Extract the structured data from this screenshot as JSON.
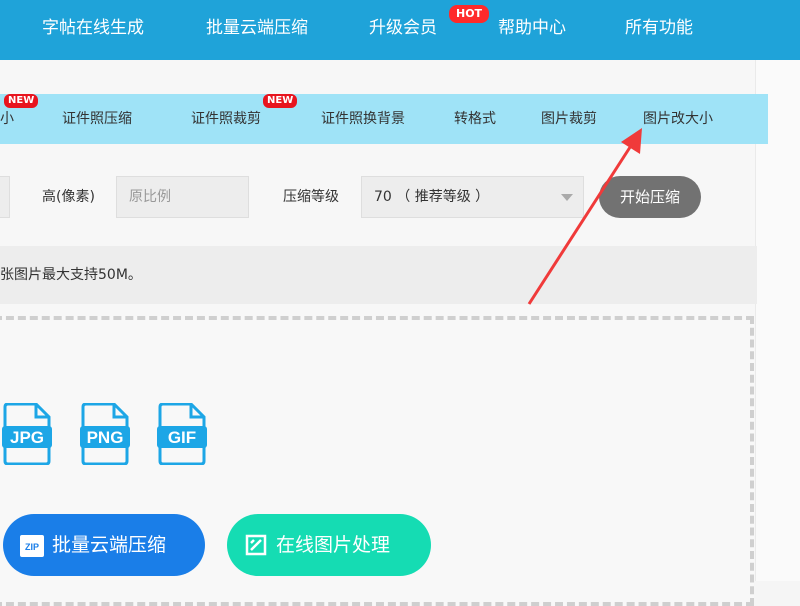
{
  "topnav": {
    "items": [
      "字帖在线生成",
      "批量云端压缩",
      "升级会员",
      "帮助中心",
      "所有功能"
    ],
    "hot_badge": "HOT"
  },
  "subnav": {
    "partial_item": "小",
    "items": [
      "证件照压缩",
      "证件照裁剪",
      "证件照换背景",
      "转格式",
      "图片裁剪",
      "图片改大小"
    ],
    "new_badge": "NEW"
  },
  "form": {
    "height_label": "高(像素)",
    "height_placeholder": "原比例",
    "level_label": "压缩等级",
    "level_value": "70 （ 推荐等级 ）",
    "start_label": "开始压缩"
  },
  "notice": "张图片最大支持50M。",
  "file_types": [
    "JPG",
    "PNG",
    "GIF"
  ],
  "buttons": {
    "cloud_label": "批量云端压缩",
    "cloud_icon_text": "ZIP",
    "online_label": "在线图片处理"
  },
  "colors": {
    "topbar": "#1fa3d9",
    "subnav": "#9fe3f7",
    "accent_blue": "#1a7ee8",
    "accent_teal": "#15dcb3",
    "file_icon": "#1da6e6",
    "badge_red": "#e8141e",
    "arrow_red": "#f03a3a"
  }
}
